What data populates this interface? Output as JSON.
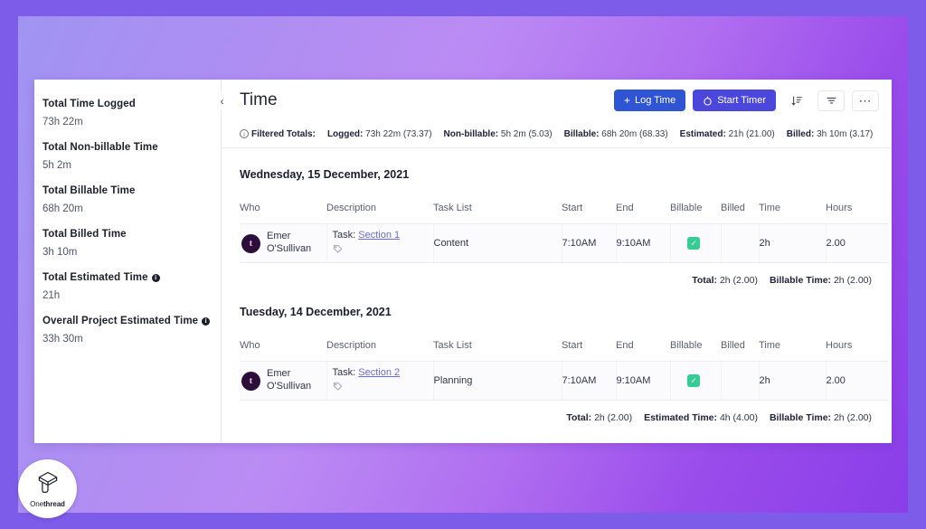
{
  "brand": {
    "logo_name_light": "One",
    "logo_name_bold": "thread",
    "accent_purple": "#7d5ce9",
    "primary_blue": "#2f54d4",
    "secondary_indigo": "#4b47dd",
    "link_color": "#6b6bd6",
    "success_green": "#35cc96"
  },
  "sidebar": {
    "stats": [
      {
        "label": "Total Time Logged",
        "value": "73h 22m",
        "info": false
      },
      {
        "label": "Total Non-billable Time",
        "value": "5h 2m",
        "info": false
      },
      {
        "label": "Total Billable Time",
        "value": "68h 20m",
        "info": false
      },
      {
        "label": "Total Billed Time",
        "value": "3h 10m",
        "info": false
      },
      {
        "label": "Total Estimated Time",
        "value": "21h",
        "info": true
      },
      {
        "label": "Overall Project Estimated Time",
        "value": "33h 30m",
        "info": true
      }
    ]
  },
  "header": {
    "title": "Time",
    "collapse_icon": "chevron-left-icon",
    "log_time_label": "Log Time",
    "log_time_icon": "plus-icon",
    "start_timer_label": "Start Timer",
    "start_timer_icon": "timer-icon",
    "sort_icon": "sort-icon",
    "filter_icon": "filter-icon",
    "more_icon": "more-horizontal-icon"
  },
  "filtered_totals": {
    "info_icon": "info-icon",
    "title": "Filtered Totals:",
    "items": [
      {
        "key": "Logged:",
        "value": "73h 22m (73.37)"
      },
      {
        "key": "Non-billable:",
        "value": "5h 2m (5.03)"
      },
      {
        "key": "Billable:",
        "value": "68h 20m (68.33)"
      },
      {
        "key": "Estimated:",
        "value": "21h (21.00)"
      },
      {
        "key": "Billed:",
        "value": "3h 10m (3.17)"
      }
    ]
  },
  "table_columns": [
    "Who",
    "Description",
    "Task List",
    "Start",
    "End",
    "Billable",
    "Billed",
    "Time",
    "Hours"
  ],
  "day_groups": [
    {
      "date": "Wednesday, 15 December, 2021",
      "rows": [
        {
          "who_first": "Emer",
          "who_last": "O'Sullivan",
          "avatar_glyph": "t",
          "desc_prefix": "Task:",
          "desc_link": "Section 1",
          "tag_icon": "tag-icon",
          "task_list": "Content",
          "start": "7:10AM",
          "end": "9:10AM",
          "billable": true,
          "billed": "",
          "time": "2h",
          "hours": "2.00"
        }
      ],
      "totals": [
        {
          "key": "Total:",
          "value": "2h (2.00)"
        },
        {
          "key": "Billable Time:",
          "value": "2h (2.00)"
        }
      ]
    },
    {
      "date": "Tuesday, 14 December, 2021",
      "rows": [
        {
          "who_first": "Emer",
          "who_last": "O'Sullivan",
          "avatar_glyph": "t",
          "desc_prefix": "Task:",
          "desc_link": "Section 2",
          "tag_icon": "tag-icon",
          "task_list": "Planning",
          "start": "7:10AM",
          "end": "9:10AM",
          "billable": true,
          "billed": "",
          "time": "2h",
          "hours": "2.00"
        }
      ],
      "totals": [
        {
          "key": "Total:",
          "value": "2h (2.00)"
        },
        {
          "key": "Estimated Time:",
          "value": "4h (4.00)"
        },
        {
          "key": "Billable Time:",
          "value": "2h (2.00)"
        }
      ]
    }
  ]
}
